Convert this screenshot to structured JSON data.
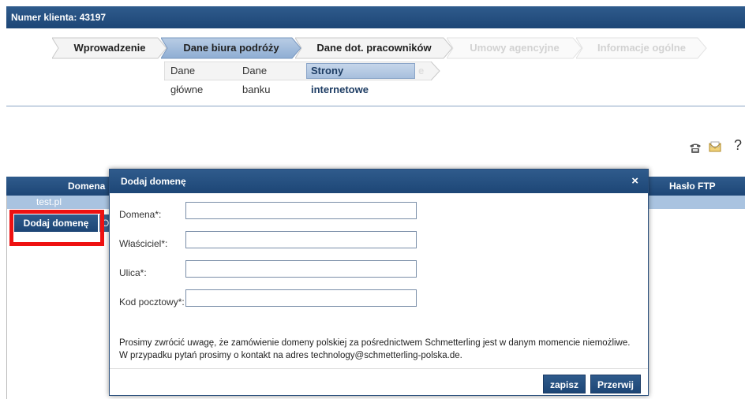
{
  "header": {
    "client_number": "Numer klienta: 43197"
  },
  "wizard": {
    "steps": [
      {
        "label": "Wprowadzenie",
        "state": "done"
      },
      {
        "label": "Dane biura podróży",
        "state": "active"
      },
      {
        "label": "Dane dot. pracowników",
        "state": "done"
      },
      {
        "label": "Umowy agencyjne",
        "state": "disabled"
      },
      {
        "label": "Informacje ogólne",
        "state": "disabled"
      }
    ],
    "subtabs": [
      {
        "label": "Dane główne"
      },
      {
        "label": "Dane banku"
      },
      {
        "label": "Strony internetowe",
        "active": true
      }
    ],
    "ghost_suffix": "e"
  },
  "toolbar": {
    "icons": [
      "phone-icon",
      "mail-icon"
    ],
    "help": "?"
  },
  "grid": {
    "columns": [
      "Domena",
      "Hasło FTP"
    ],
    "rows": [
      {
        "domain": "test.pl"
      }
    ],
    "add_button": "Dodaj domenę",
    "second_button_partial": "O"
  },
  "modal": {
    "title": "Dodaj domenę",
    "close": "×",
    "fields": [
      {
        "label": "Domena*:",
        "value": ""
      },
      {
        "label": "Właściciel*:",
        "value": ""
      },
      {
        "label": "Ulica*:",
        "value": ""
      },
      {
        "label": "Kod pocztowy*:",
        "value": ""
      }
    ],
    "notice_line1": "Prosimy zwrócić uwagę, że zamówienie domeny polskiej za pośrednictwem Schmetterling jest w danym momencie niemożliwe.",
    "notice_line2": "W przypadku pytań prosimy o kontakt na adres technology@schmetterling-polska.de.",
    "save_label": "zapisz",
    "cancel_label": "Przerwij"
  },
  "colors": {
    "primary": "#1d4676",
    "highlight": "#e11111",
    "row": "#a9c3e0"
  }
}
